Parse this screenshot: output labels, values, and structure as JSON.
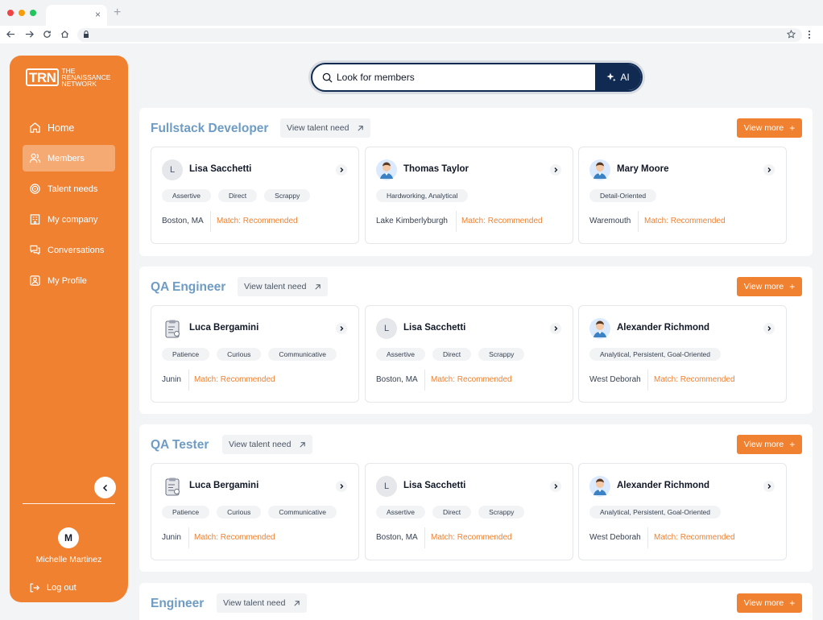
{
  "browser": {
    "tab_close": "×",
    "new_tab": "+"
  },
  "brand": {
    "logo_mark": "TRN",
    "logo_line1": "THE",
    "logo_line2": "RENAISSANCE",
    "logo_line3": "NETWORK",
    "accent": "#f08131",
    "navy": "#102a52",
    "title_blue": "#6e9cc4"
  },
  "sidebar": {
    "items": [
      {
        "label": "Home",
        "icon": "home-icon"
      },
      {
        "label": "Members",
        "icon": "users-icon",
        "active": true
      },
      {
        "label": "Talent needs",
        "icon": "target-icon"
      },
      {
        "label": "My company",
        "icon": "building-icon"
      },
      {
        "label": "Conversations",
        "icon": "chat-icon"
      },
      {
        "label": "My Profile",
        "icon": "profile-icon"
      }
    ],
    "user_initial": "M",
    "user_name": "Michelle Martinez",
    "logout_label": "Log out"
  },
  "search": {
    "placeholder": "Look for members",
    "ai_label": "AI"
  },
  "sections": [
    {
      "title": "Fullstack Developer",
      "talent_link": "View talent need",
      "view_more": "View more",
      "cards": [
        {
          "name": "Lisa Sacchetti",
          "initial": "L",
          "tags": [
            "Assertive",
            "Direct",
            "Scrappy"
          ],
          "location": "Boston, MA",
          "match": "Match: Recommended"
        },
        {
          "name": "Thomas Taylor",
          "tags": [
            "Hardworking, Analytical"
          ],
          "location": "Lake Kimberlyburgh",
          "match": "Match: Recommended"
        },
        {
          "name": "Mary Moore",
          "tags": [
            "Detail-Oriented"
          ],
          "location": "Waremouth",
          "match": "Match: Recommended"
        }
      ]
    },
    {
      "title": "QA Engineer",
      "talent_link": "View talent need",
      "view_more": "View more",
      "cards": [
        {
          "name": "Luca Bergamini",
          "tags": [
            "Patience",
            "Curious",
            "Communicative"
          ],
          "location": "Junin",
          "match": "Match: Recommended"
        },
        {
          "name": "Lisa Sacchetti",
          "initial": "L",
          "tags": [
            "Assertive",
            "Direct",
            "Scrappy"
          ],
          "location": "Boston, MA",
          "match": "Match: Recommended"
        },
        {
          "name": "Alexander Richmond",
          "tags": [
            "Analytical, Persistent, Goal-Oriented"
          ],
          "location": "West Deborah",
          "match": "Match: Recommended"
        }
      ]
    },
    {
      "title": "QA Tester",
      "talent_link": "View talent need",
      "view_more": "View more",
      "cards": [
        {
          "name": "Luca Bergamini",
          "tags": [
            "Patience",
            "Curious",
            "Communicative"
          ],
          "location": "Junin",
          "match": "Match: Recommended"
        },
        {
          "name": "Lisa Sacchetti",
          "initial": "L",
          "tags": [
            "Assertive",
            "Direct",
            "Scrappy"
          ],
          "location": "Boston, MA",
          "match": "Match: Recommended"
        },
        {
          "name": "Alexander Richmond",
          "tags": [
            "Analytical, Persistent, Goal-Oriented"
          ],
          "location": "West Deborah",
          "match": "Match: Recommended"
        }
      ]
    },
    {
      "title": "Engineer",
      "talent_link": "View talent need",
      "view_more": "View more",
      "cards": []
    }
  ]
}
